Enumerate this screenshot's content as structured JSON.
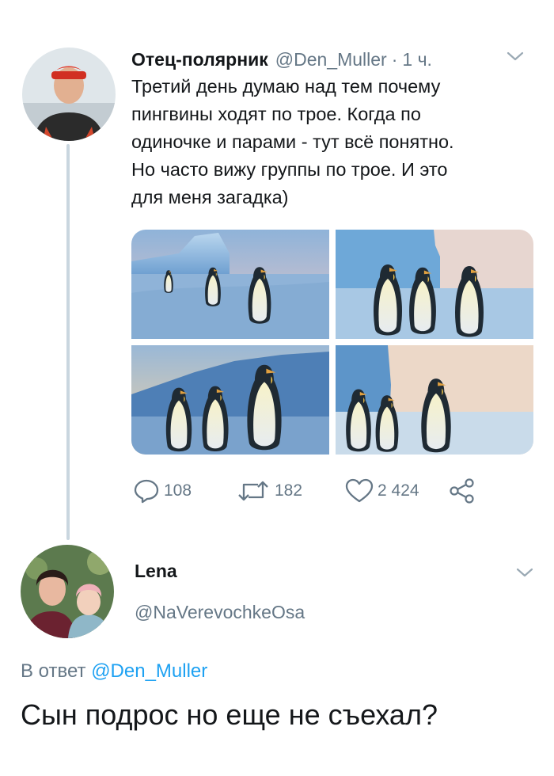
{
  "tweet": {
    "author_name": "Отец-полярник",
    "handle": "@Den_Muller",
    "separator": "·",
    "time": "1 ч.",
    "text_lines": [
      "Третий день думаю над тем почему",
      "пингвины ходят по трое. Когда по",
      "одиночке и парами - тут всё понятно.",
      "Но часто вижу группы по трое. И это",
      "для меня загадка)"
    ],
    "media_count": 4,
    "stats": {
      "replies": "108",
      "retweets": "182",
      "likes": "2 424"
    }
  },
  "reply": {
    "author_name": "Lena",
    "handle": "@NaVerevochkeOsa",
    "in_reply_prefix": "В ответ",
    "in_reply_mention": "@Den_Muller",
    "text": "Сын подрос но еще не съехал?"
  },
  "icons": {
    "reply": "speech-bubble-icon",
    "retweet": "retweet-icon",
    "like": "heart-icon",
    "share": "share-icon",
    "menu": "chevron-down-icon"
  },
  "colors": {
    "text": "#14171a",
    "secondary": "#657786",
    "accent": "#1da1f2",
    "thread_line": "#c9d6df"
  }
}
